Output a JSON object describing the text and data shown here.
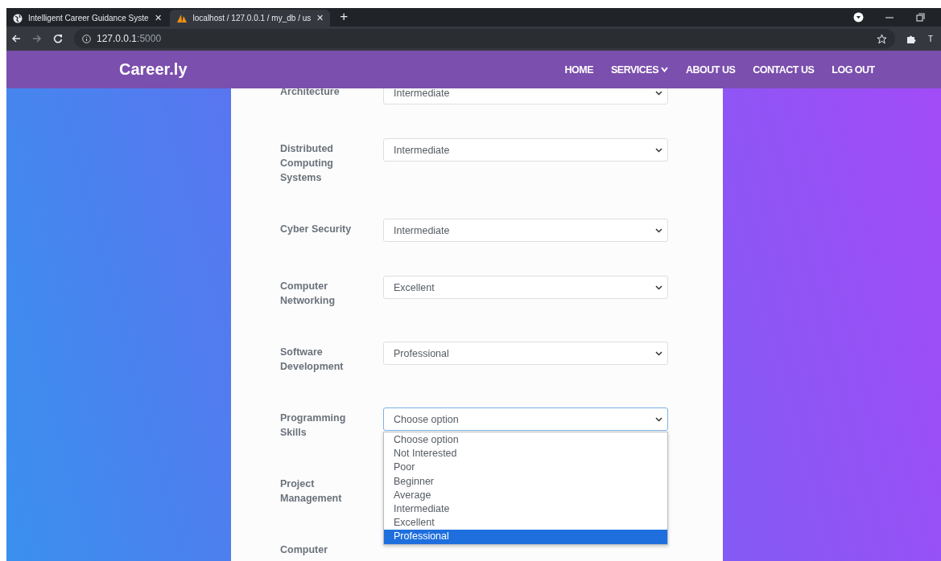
{
  "browser": {
    "tabs": [
      {
        "title": "Intelligent Career Guidance Syste",
        "selected": false,
        "kind": "globe"
      },
      {
        "title": "localhost / 127.0.0.1 / my_db / us",
        "selected": true,
        "kind": "db"
      }
    ],
    "tab_close": "✕",
    "new_tab": "+",
    "address": {
      "host": "127.0.0.1",
      "port": ":5000"
    },
    "profile": "T"
  },
  "navbar": {
    "brand": "Career.ly",
    "links": [
      {
        "label": "HOME",
        "dropdown": false
      },
      {
        "label": "SERVICES",
        "dropdown": true
      },
      {
        "label": "ABOUT US",
        "dropdown": false
      },
      {
        "label": "CONTACT US",
        "dropdown": false
      },
      {
        "label": "LOG OUT",
        "dropdown": false
      }
    ]
  },
  "form": {
    "fields": [
      {
        "label": "Architecture",
        "value": "Intermediate",
        "focused": false
      },
      {
        "label": "Distributed Computing Systems",
        "value": "Intermediate",
        "focused": false
      },
      {
        "label": "Cyber Security",
        "value": "Intermediate",
        "focused": false
      },
      {
        "label": "Computer Networking",
        "value": "Excellent",
        "focused": false
      },
      {
        "label": "Software Development",
        "value": "Professional",
        "focused": false
      },
      {
        "label": "Programming Skills",
        "value": "Choose option",
        "focused": true,
        "options": [
          {
            "label": "Choose option",
            "highlighted": false
          },
          {
            "label": "Not Interested",
            "highlighted": false
          },
          {
            "label": "Poor",
            "highlighted": false
          },
          {
            "label": "Beginner",
            "highlighted": false
          },
          {
            "label": "Average",
            "highlighted": false
          },
          {
            "label": "Intermediate",
            "highlighted": false
          },
          {
            "label": "Excellent",
            "highlighted": false
          },
          {
            "label": "Professional",
            "highlighted": true
          }
        ]
      },
      {
        "label": "Project Management"
      },
      {
        "label": "Computer"
      }
    ]
  }
}
